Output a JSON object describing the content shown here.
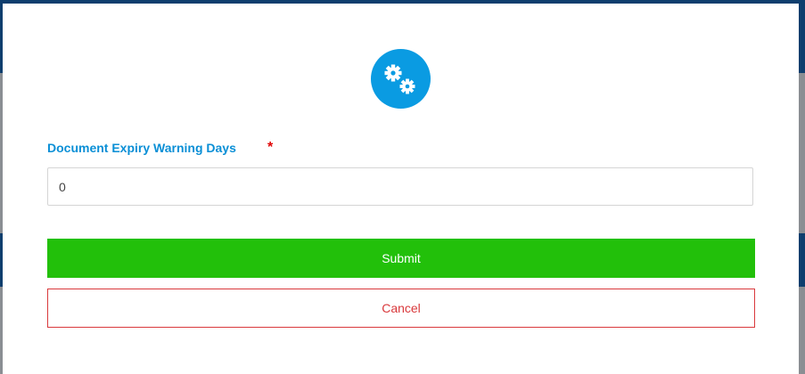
{
  "form": {
    "icon": "gears-icon",
    "label": "Document Expiry Warning Days",
    "required_mark": "*",
    "input_value": "0",
    "submit_label": "Submit",
    "cancel_label": "Cancel"
  },
  "colors": {
    "accent": "#0a9be2",
    "label": "#0a8fd6",
    "required": "#e00000",
    "submit_bg": "#22c00a",
    "cancel": "#d9393c"
  }
}
